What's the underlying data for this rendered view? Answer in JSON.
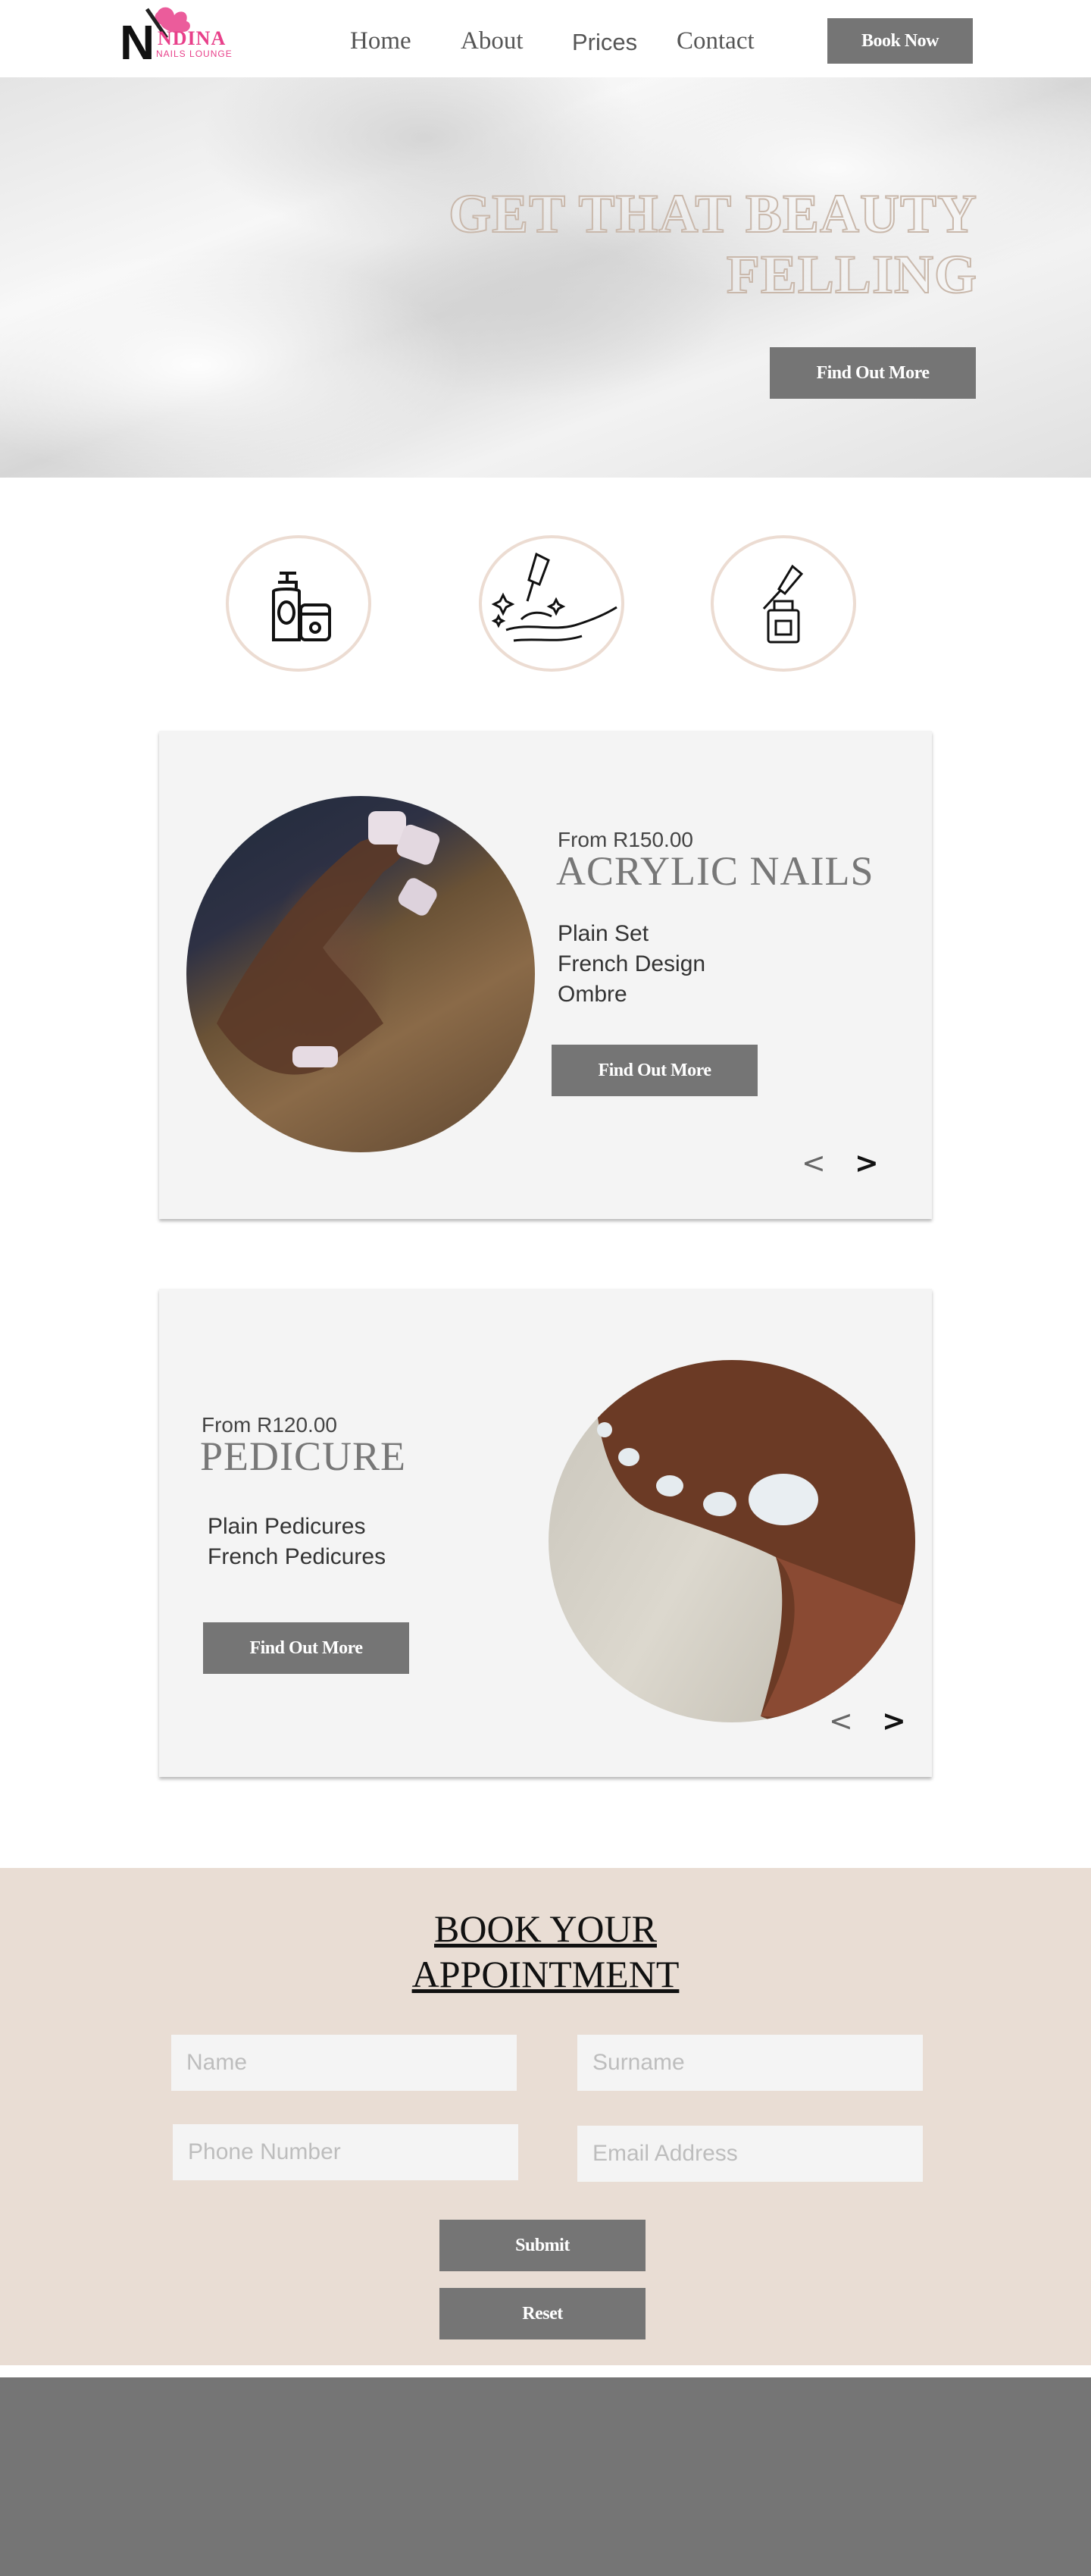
{
  "nav": {
    "logo_text": "NDINA",
    "logo_subtext": "NAILS LOUNGE",
    "links": [
      "Home",
      "About",
      "Prices",
      "Contact"
    ],
    "book_button": "Book Now"
  },
  "hero": {
    "title_line1": "GET THAT BEAUTY",
    "title_line2": "FELLING",
    "cta": "Find Out More"
  },
  "features": [
    {
      "icon": "lotion-bottle-icon"
    },
    {
      "icon": "nail-polish-hand-icon"
    },
    {
      "icon": "serum-dropper-icon"
    }
  ],
  "cards": [
    {
      "price": "From R150.00",
      "title": "ACRYLIC NAILS",
      "items": [
        "Plain Set",
        "French Design",
        "Ombre"
      ],
      "cta": "Find Out More",
      "prev": "<",
      "next": ">"
    },
    {
      "price": "From R120.00",
      "title": "PEDICURE",
      "items": [
        "Plain Pedicures",
        "French Pedicures"
      ],
      "cta": "Find Out More",
      "prev": "<",
      "next": ">"
    }
  ],
  "booking": {
    "title_line1": "BOOK YOUR",
    "title_line2": "APPOINTMENT",
    "name_placeholder": "Name",
    "surname_placeholder": "Surname",
    "phone_placeholder": "Phone Number",
    "email_placeholder": "Email Address",
    "submit": "Submit",
    "reset": "Reset"
  },
  "colors": {
    "button": "#757575",
    "accent_beige": "#e9ddd4",
    "card_bg": "#f4f4f4",
    "logo_pink": "#e8408a",
    "footer": "#757575"
  }
}
